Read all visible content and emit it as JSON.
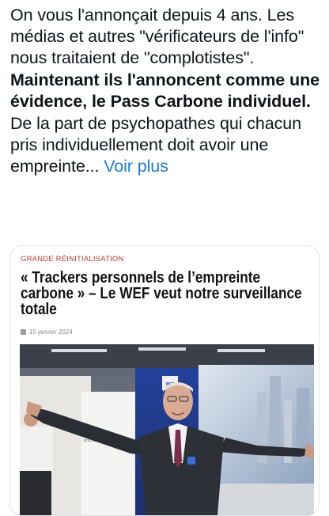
{
  "post": {
    "text_1": "On vous l'annonçait depuis 4 ans. Les médias et autres \"vérificateurs de l'info\" nous traitaient de \"complotistes\".",
    "text_bold": "Maintenant ils l'annoncent comme une évidence, le Pass Carbone individuel.",
    "text_2": "De la part de psychopathes qui chacun pris individuellement doit avoir une empreinte...",
    "more_label": "Voir plus"
  },
  "card": {
    "category": "GRANDE RÉINITIALISATION",
    "headline": "« Trackers personnels de l’empreinte carbone » – Le WEF veut notre surveillance totale",
    "date": "15 janvier 2024",
    "photo": {
      "banner_text": "SOCIAL ENTREPRENEURSHIP",
      "badge_text": "WEF"
    }
  },
  "colors": {
    "link": "#1d7bd8",
    "category": "#c0392b",
    "card_border": "#e3e6ea"
  }
}
